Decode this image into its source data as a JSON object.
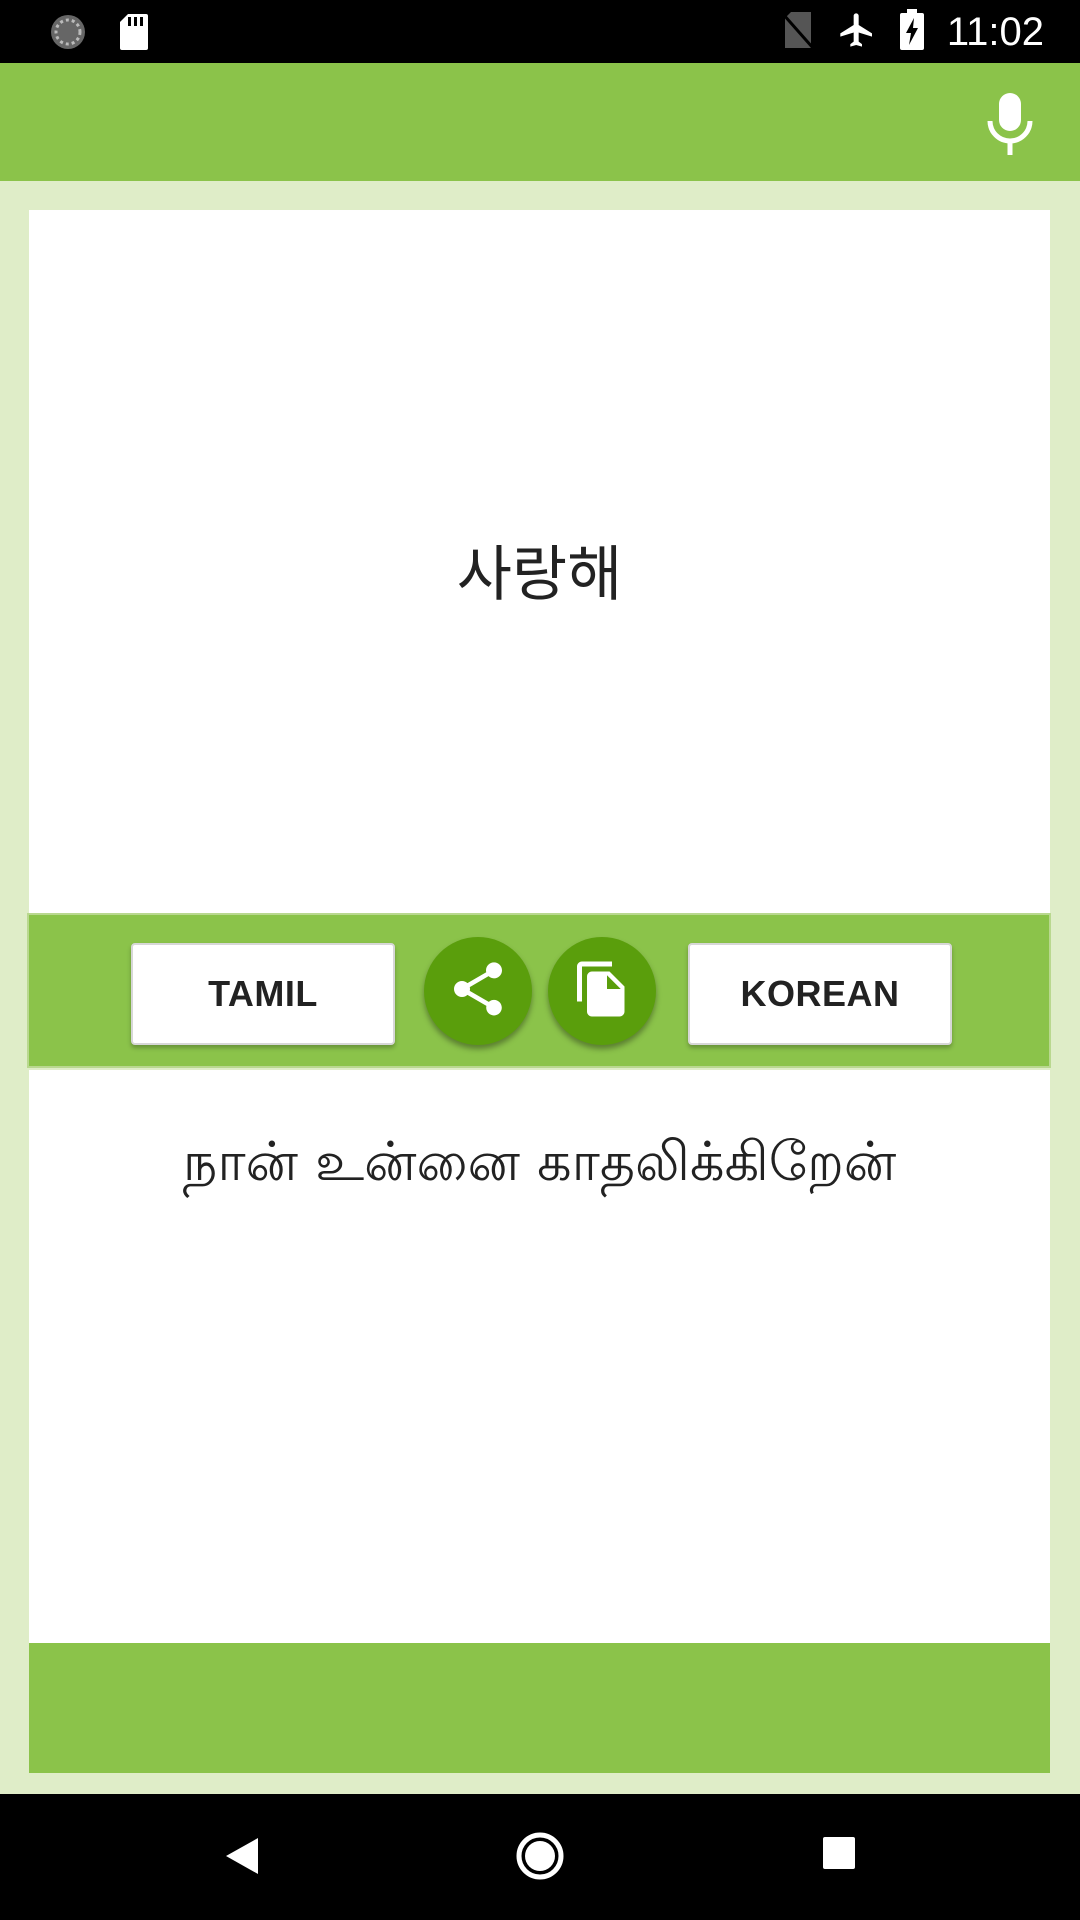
{
  "status_bar": {
    "time": "11:02",
    "icons": [
      "sync-icon",
      "sd-card-icon",
      "no-sim-icon",
      "airplane-icon",
      "battery-charging-icon"
    ]
  },
  "app_bar": {
    "mic_icon": "microphone-icon"
  },
  "source_panel": {
    "text": "사랑해"
  },
  "controls": {
    "left_language": "TAMIL",
    "right_language": "KOREAN",
    "share_icon": "share-icon",
    "copy_icon": "copy-icon"
  },
  "target_panel": {
    "text": "நான் உன்னை காதலிக்கிறேன்"
  },
  "nav_bar": {
    "icons": [
      "back-icon",
      "home-icon",
      "recent-apps-icon"
    ]
  },
  "colors": {
    "primary": "#8bc34a",
    "primary_dark": "#5a9e0c",
    "background": "#dfedc8"
  }
}
